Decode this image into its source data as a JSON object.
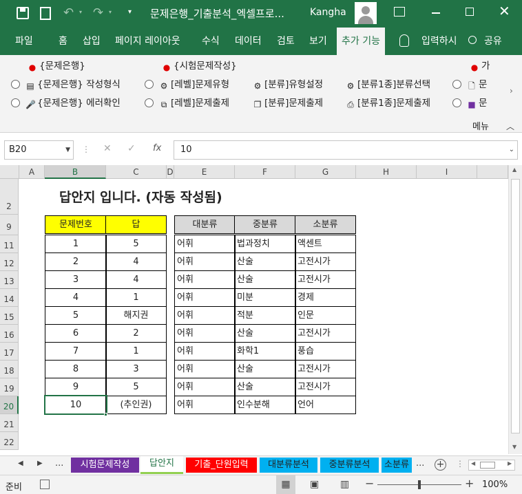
{
  "titlebar": {
    "title": "문제은행_기출분석_엑셀프로...",
    "user": "Kangha",
    "save_icon": "save-icon",
    "colors": {
      "bg": "#217346"
    }
  },
  "tabs": [
    "파일",
    "홈",
    "삽입",
    "페이지 레이아웃",
    "수식",
    "데이터",
    "검토",
    "보기",
    "추가 기능"
  ],
  "tell_me": "입력하시",
  "share": "공유",
  "ribbon": {
    "row1": [
      "{문제은행}",
      "{시험문제작성}",
      "가"
    ],
    "row2": [
      "{문제은행} 작성형식",
      "[레벨]문제유형",
      "[분류]유형설정",
      "[분류1종]분류선택",
      "문"
    ],
    "row3": [
      "{문제은행} 에러확인",
      "[레벨]문제출제",
      "[분류]문제출제",
      "[분류1종]문제출제",
      "문"
    ],
    "menu": "메뉴"
  },
  "formula": {
    "name_box": "B20",
    "value": "10",
    "fx": "fx"
  },
  "columns": [
    "A",
    "B",
    "C",
    "D",
    "E",
    "F",
    "G",
    "H",
    "I"
  ],
  "rows": [
    "2",
    "9",
    "11",
    "12",
    "13",
    "14",
    "15",
    "16",
    "17",
    "18",
    "19",
    "20",
    "21",
    "22"
  ],
  "sheet": {
    "title": "답안지 입니다. (자동 작성됨)",
    "answer_headers": [
      "문제번호",
      "답"
    ],
    "class_headers": [
      "대분류",
      "중분류",
      "소분류"
    ],
    "answers": [
      [
        "1",
        "5"
      ],
      [
        "2",
        "4"
      ],
      [
        "3",
        "4"
      ],
      [
        "4",
        "1"
      ],
      [
        "5",
        "해지권"
      ],
      [
        "6",
        "2"
      ],
      [
        "7",
        "1"
      ],
      [
        "8",
        "3"
      ],
      [
        "9",
        "5"
      ],
      [
        "10",
        "(추인권)"
      ]
    ],
    "classes": [
      [
        "어휘",
        "법과정치",
        "액센트"
      ],
      [
        "어휘",
        "산술",
        "고전시가"
      ],
      [
        "어휘",
        "산술",
        "고전시가"
      ],
      [
        "어휘",
        "미분",
        "경제"
      ],
      [
        "어휘",
        "적분",
        "인문"
      ],
      [
        "어휘",
        "산술",
        "고전시가"
      ],
      [
        "어휘",
        "화학1",
        "풍습"
      ],
      [
        "어휘",
        "산술",
        "고전시가"
      ],
      [
        "어휘",
        "산술",
        "고전시가"
      ],
      [
        "어휘",
        "인수분해",
        "언어"
      ]
    ],
    "colors": {
      "header_yellow": "#ffff00",
      "header_gray": "#d9d9d9"
    }
  },
  "sheet_tabs": [
    {
      "label": "시험문제작성",
      "bg": "#7030a0",
      "fg": "#ffffff"
    },
    {
      "label": "답안지",
      "bg": "#ffffff",
      "fg": "#217346"
    },
    {
      "label": "기출_단원입력",
      "bg": "#ff0000",
      "fg": "#ffffff"
    },
    {
      "label": "대분류분석",
      "bg": "#00b0f0",
      "fg": "#222222"
    },
    {
      "label": "중분류분석",
      "bg": "#00b0f0",
      "fg": "#222222"
    },
    {
      "label": "소분류",
      "bg": "#00b0f0",
      "fg": "#222222"
    }
  ],
  "status": {
    "ready": "준비",
    "zoom": "100%"
  }
}
